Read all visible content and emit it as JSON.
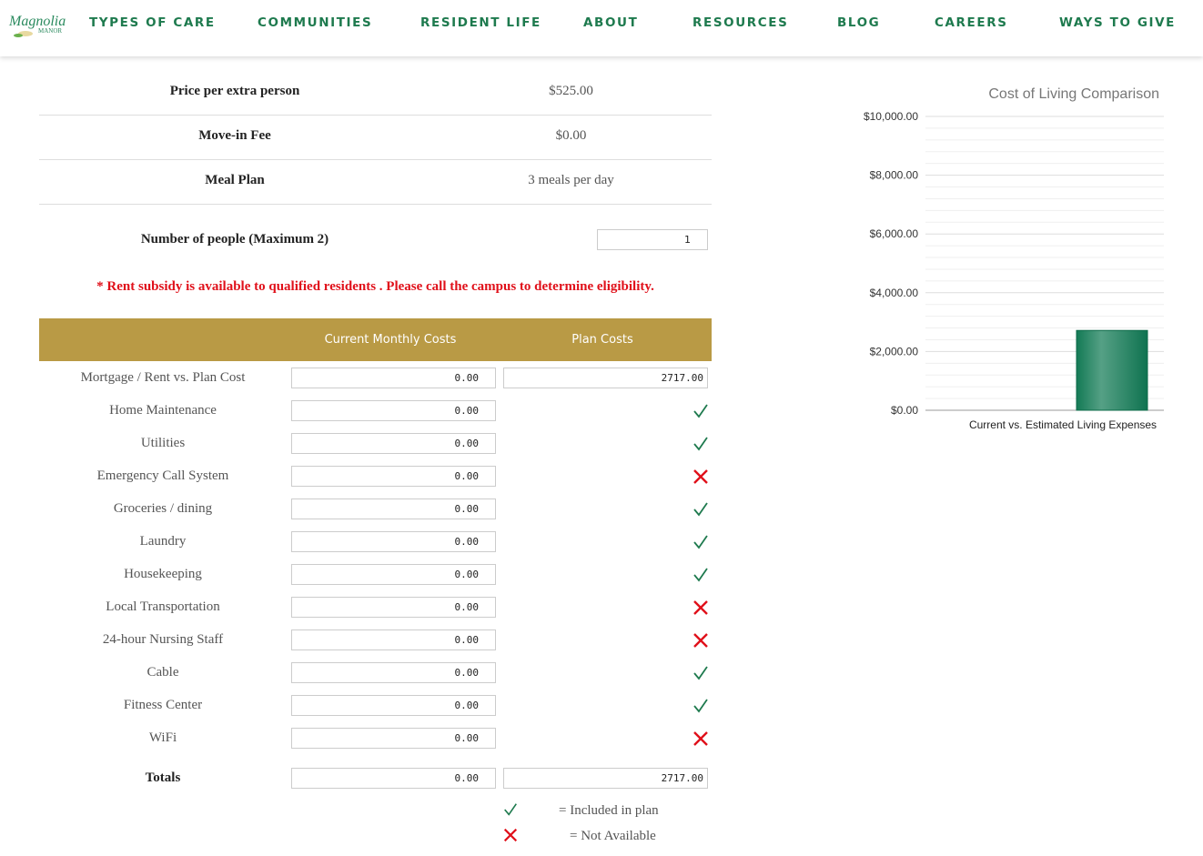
{
  "nav": {
    "logo": "Magnolia Manor Senior Living",
    "items": [
      "TYPES OF CARE",
      "COMMUNITIES",
      "RESIDENT LIFE",
      "ABOUT",
      "RESOURCES",
      "BLOG",
      "CAREERS",
      "WAYS TO GIVE"
    ]
  },
  "info": [
    {
      "label": "Price per extra person",
      "value": "$525.00"
    },
    {
      "label": "Move-in Fee",
      "value": "$0.00"
    },
    {
      "label": "Meal Plan",
      "value": "3 meals per day"
    }
  ],
  "people": {
    "label": "Number of people (Maximum 2)",
    "value": "1"
  },
  "subsidy": "* Rent subsidy is available to qualified residents . Please call the campus to determine eligibility.",
  "table": {
    "headers": [
      "Current Monthly Costs",
      "Plan Costs"
    ],
    "rows": [
      {
        "label": "Mortgage / Rent vs. Plan Cost",
        "current": "0.00",
        "plan": "2717.00"
      },
      {
        "label": "Home Maintenance",
        "current": "0.00",
        "plan": "check"
      },
      {
        "label": "Utilities",
        "current": "0.00",
        "plan": "check"
      },
      {
        "label": "Emergency Call System",
        "current": "0.00",
        "plan": "x"
      },
      {
        "label": "Groceries / dining",
        "current": "0.00",
        "plan": "check"
      },
      {
        "label": "Laundry",
        "current": "0.00",
        "plan": "check"
      },
      {
        "label": "Housekeeping",
        "current": "0.00",
        "plan": "check"
      },
      {
        "label": "Local Transportation",
        "current": "0.00",
        "plan": "x"
      },
      {
        "label": "24-hour Nursing Staff",
        "current": "0.00",
        "plan": "x"
      },
      {
        "label": "Cable",
        "current": "0.00",
        "plan": "check"
      },
      {
        "label": "Fitness Center",
        "current": "0.00",
        "plan": "check"
      },
      {
        "label": "WiFi",
        "current": "0.00",
        "plan": "x"
      }
    ],
    "totals": {
      "label": "Totals",
      "current": "0.00",
      "plan": "2717.00"
    }
  },
  "legend": {
    "included": "= Included in plan",
    "not_available": "= Not Available"
  },
  "colors": {
    "brand": "#1e7a4e",
    "gold": "#b99a45",
    "check": "#1e7a4e",
    "x": "#e0101a",
    "bar": "#137a55"
  },
  "chart_data": {
    "type": "bar",
    "title": "Cost of Living Comparison",
    "categories": [
      "Current vs. Estimated Living Expenses"
    ],
    "series": [
      {
        "values": [
          0
        ]
      },
      {
        "values": [
          2717
        ]
      }
    ],
    "ylim": [
      0,
      10000
    ],
    "yticks": [
      "$0.00",
      "$2,000.00",
      "$4,000.00",
      "$6,000.00",
      "$8,000.00",
      "$10,000.00"
    ],
    "grid": true
  }
}
